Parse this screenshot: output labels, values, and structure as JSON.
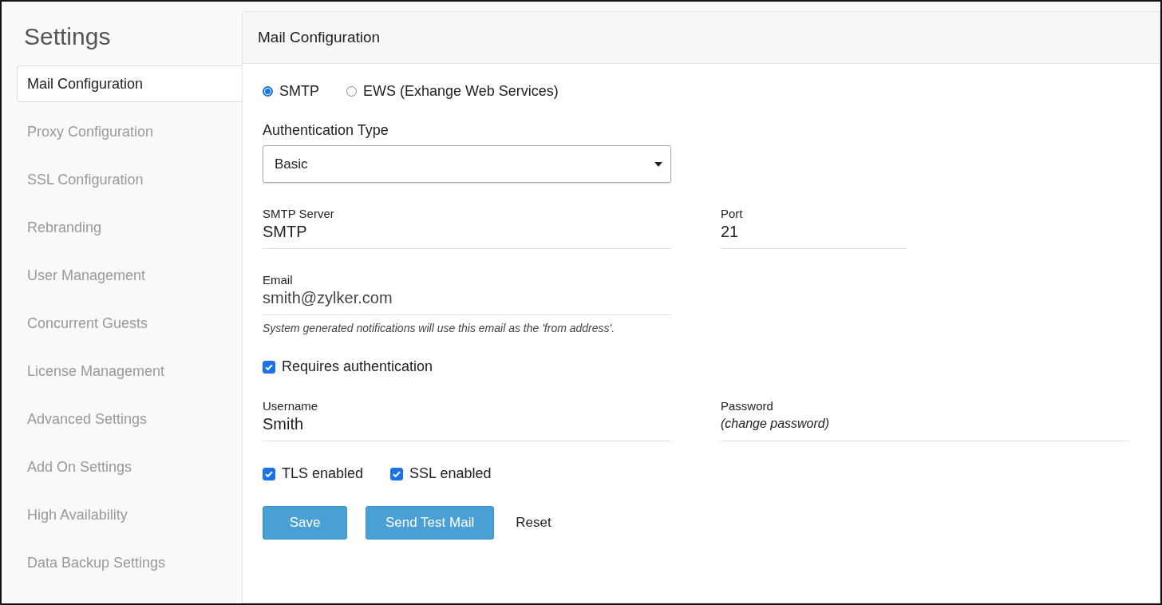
{
  "sidebar": {
    "title": "Settings",
    "items": [
      {
        "label": "Mail Configuration",
        "selected": true
      },
      {
        "label": "Proxy Configuration",
        "selected": false
      },
      {
        "label": "SSL Configuration",
        "selected": false
      },
      {
        "label": "Rebranding",
        "selected": false
      },
      {
        "label": "User Management",
        "selected": false
      },
      {
        "label": "Concurrent Guests",
        "selected": false
      },
      {
        "label": "License Management",
        "selected": false
      },
      {
        "label": "Advanced Settings",
        "selected": false
      },
      {
        "label": "Add On Settings",
        "selected": false
      },
      {
        "label": "High Availability",
        "selected": false
      },
      {
        "label": "Data Backup Settings",
        "selected": false
      }
    ]
  },
  "panel": {
    "title": "Mail Configuration",
    "protocols": [
      {
        "label": "SMTP",
        "selected": true
      },
      {
        "label": "EWS (Exhange Web Services)",
        "selected": false
      }
    ],
    "auth_type": {
      "label": "Authentication Type",
      "value": "Basic"
    },
    "server": {
      "label": "SMTP Server",
      "value": "SMTP"
    },
    "port": {
      "label": "Port",
      "value": "21"
    },
    "email": {
      "label": "Email",
      "value": "smith@zylker.com",
      "note": "System generated notifications will use this email as the 'from address'."
    },
    "requires_auth": {
      "label": "Requires authentication",
      "checked": true
    },
    "username": {
      "label": "Username",
      "value": "Smith"
    },
    "password": {
      "label": "Password",
      "value": "(change password)"
    },
    "options": [
      {
        "label": "TLS enabled",
        "checked": true
      },
      {
        "label": "SSL enabled",
        "checked": true
      }
    ],
    "buttons": [
      {
        "label": "Save",
        "kind": "primary"
      },
      {
        "label": "Send Test Mail",
        "kind": "primary"
      },
      {
        "label": "Reset",
        "kind": "plain"
      }
    ]
  }
}
